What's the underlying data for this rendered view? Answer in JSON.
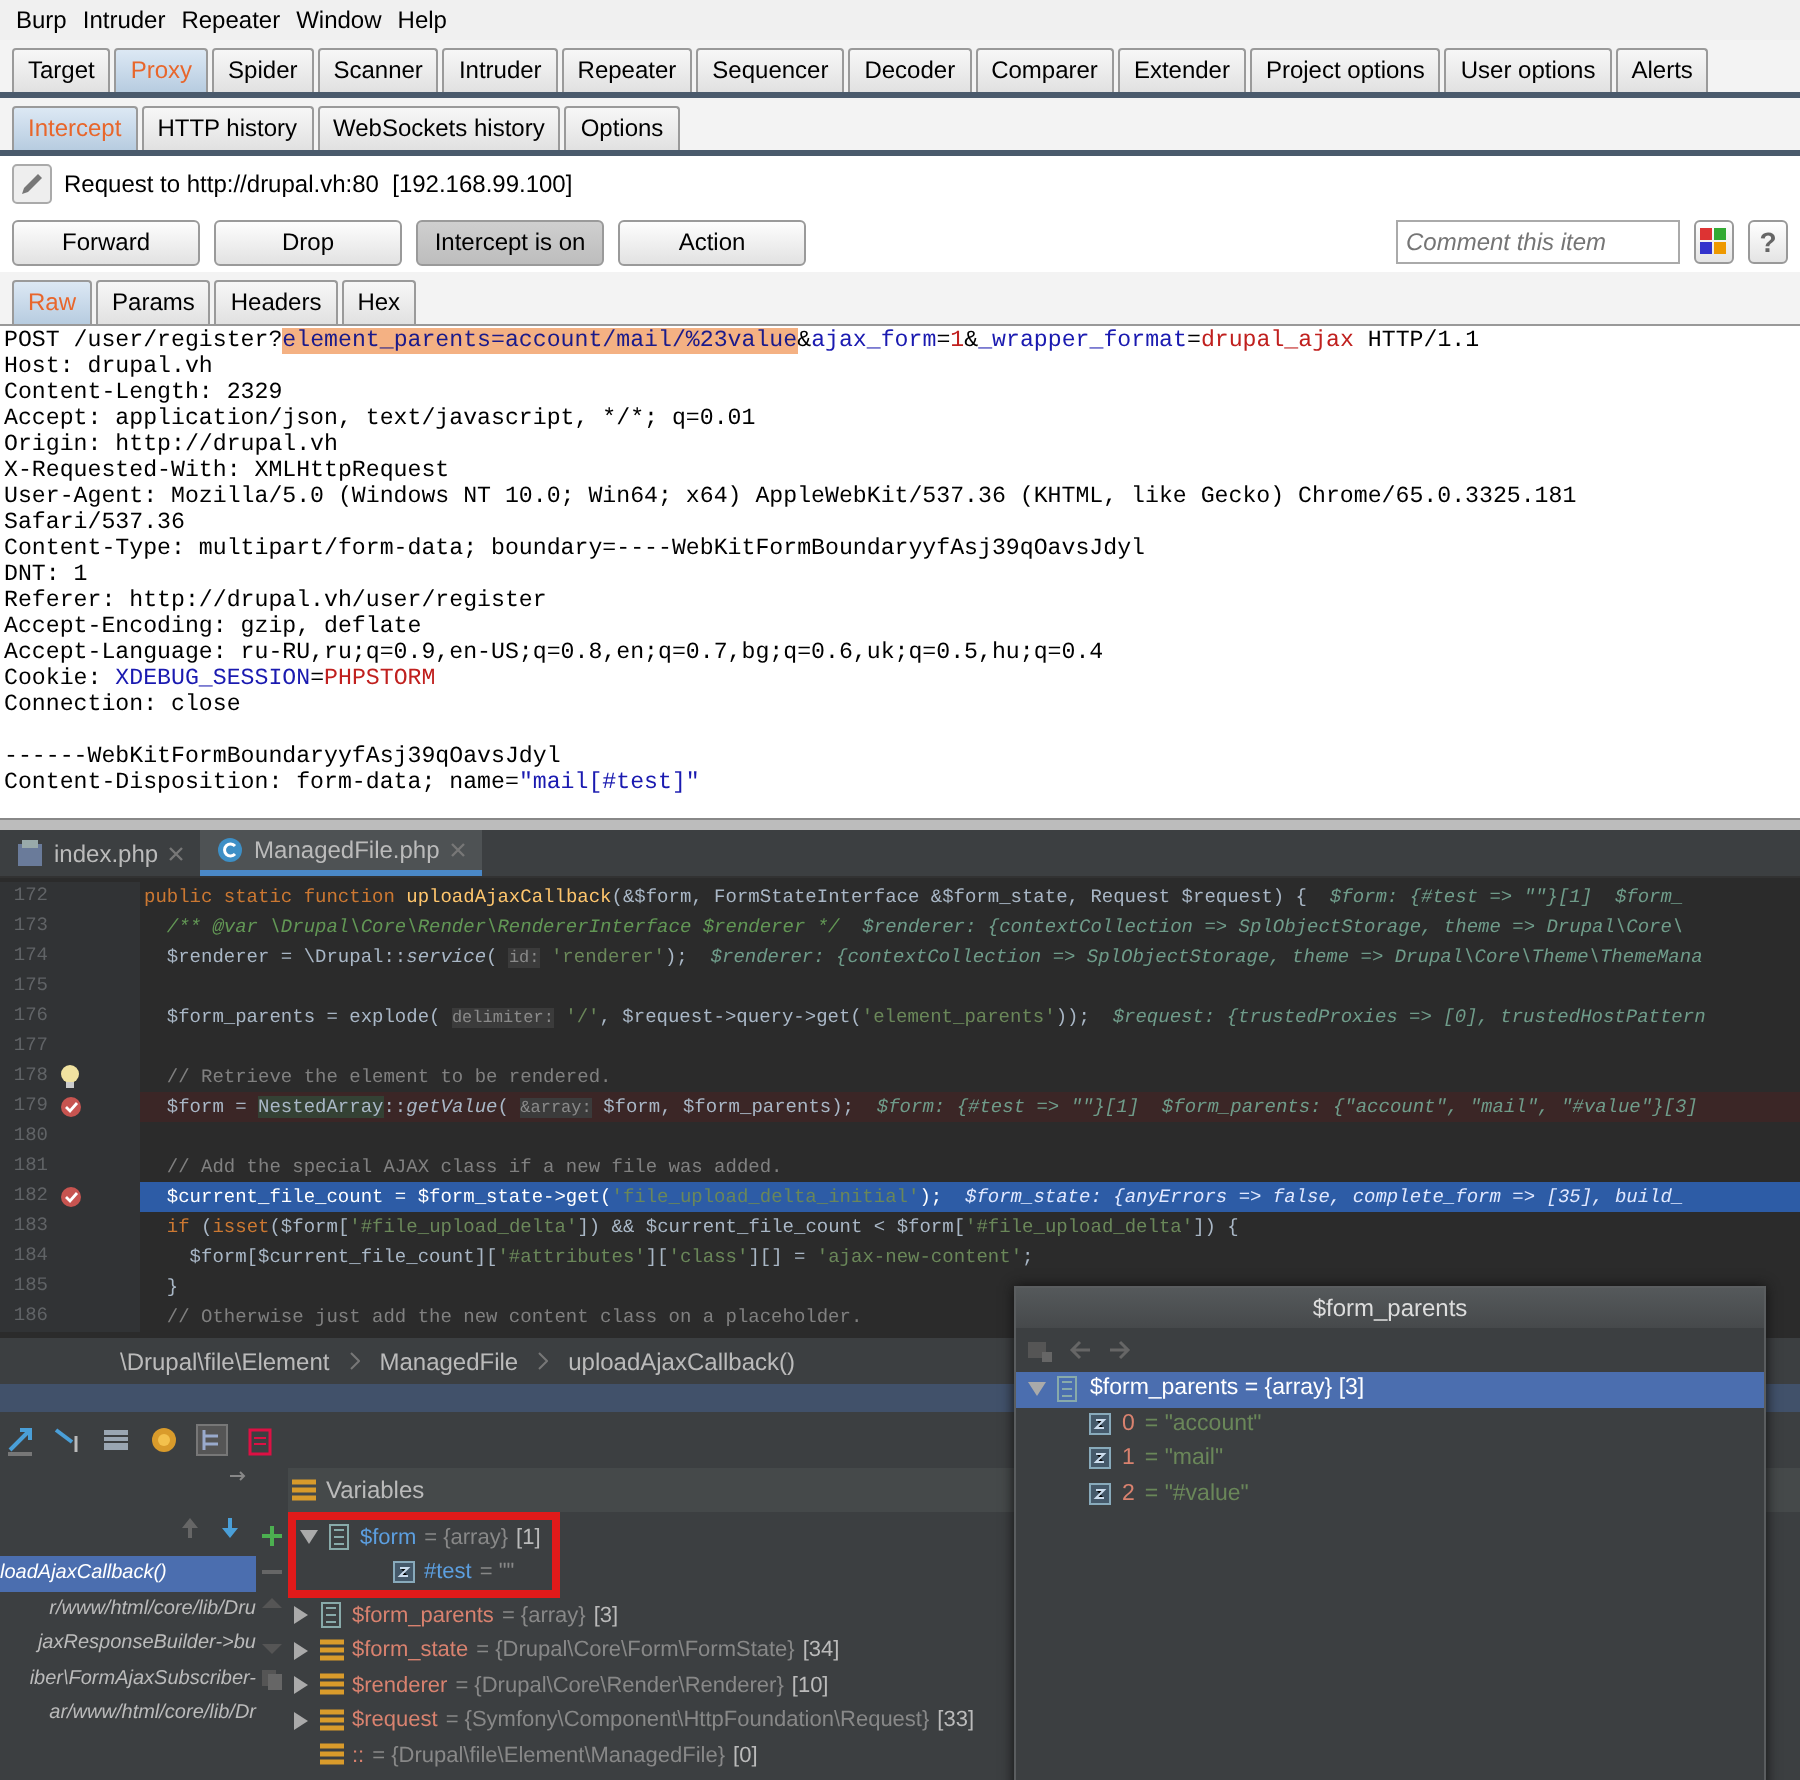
{
  "menu": [
    "Burp",
    "Intruder",
    "Repeater",
    "Window",
    "Help"
  ],
  "tabs": [
    {
      "label": "Target",
      "selected": false
    },
    {
      "label": "Proxy",
      "selected": true
    },
    {
      "label": "Spider",
      "selected": false
    },
    {
      "label": "Scanner",
      "selected": false
    },
    {
      "label": "Intruder",
      "selected": false
    },
    {
      "label": "Repeater",
      "selected": false
    },
    {
      "label": "Sequencer",
      "selected": false
    },
    {
      "label": "Decoder",
      "selected": false
    },
    {
      "label": "Comparer",
      "selected": false
    },
    {
      "label": "Extender",
      "selected": false
    },
    {
      "label": "Project options",
      "selected": false
    },
    {
      "label": "User options",
      "selected": false
    },
    {
      "label": "Alerts",
      "selected": false
    }
  ],
  "subtabs": [
    {
      "label": "Intercept",
      "selected": true
    },
    {
      "label": "HTTP history",
      "selected": false
    },
    {
      "label": "WebSockets history",
      "selected": false
    },
    {
      "label": "Options",
      "selected": false
    }
  ],
  "request_target": "Request to http://drupal.vh:80  [192.168.99.100]",
  "buttons": [
    {
      "label": "Forward",
      "pressed": false
    },
    {
      "label": "Drop",
      "pressed": false
    },
    {
      "label": "Intercept is on",
      "pressed": true
    },
    {
      "label": "Action",
      "pressed": false
    }
  ],
  "comment": {
    "placeholder": "Comment this item"
  },
  "help_button": "?",
  "view_tabs": [
    {
      "label": "Raw",
      "selected": true
    },
    {
      "label": "Params",
      "selected": false
    },
    {
      "label": "Headers",
      "selected": false
    },
    {
      "label": "Hex",
      "selected": false
    }
  ],
  "request_lines": [
    [
      {
        "text": "POST /user/register?",
        "kind": "plain"
      },
      {
        "text": "element_parents=account/mail/%23value",
        "kind": "selection"
      },
      {
        "text": "&",
        "kind": "plain"
      },
      {
        "text": "ajax_form",
        "kind": "key"
      },
      {
        "text": "=",
        "kind": "plain"
      },
      {
        "text": "1",
        "kind": "value"
      },
      {
        "text": "&",
        "kind": "plain"
      },
      {
        "text": "_wrapper_format",
        "kind": "key"
      },
      {
        "text": "=",
        "kind": "plain"
      },
      {
        "text": "drupal_ajax",
        "kind": "value"
      },
      {
        "text": " HTTP/1.1",
        "kind": "plain"
      }
    ],
    [
      {
        "text": "Host: drupal.vh",
        "kind": "plain"
      }
    ],
    [
      {
        "text": "Content-Length: 2329",
        "kind": "plain"
      }
    ],
    [
      {
        "text": "Accept: application/json, text/javascript, */*; q=0.01",
        "kind": "plain"
      }
    ],
    [
      {
        "text": "Origin: http://drupal.vh",
        "kind": "plain"
      }
    ],
    [
      {
        "text": "X-Requested-With: XMLHttpRequest",
        "kind": "plain"
      }
    ],
    [
      {
        "text": "User-Agent: Mozilla/5.0 (Windows NT 10.0; Win64; x64) AppleWebKit/537.36 (KHTML, like Gecko) Chrome/65.0.3325.181",
        "kind": "plain"
      }
    ],
    [
      {
        "text": "Safari/537.36",
        "kind": "plain"
      }
    ],
    [
      {
        "text": "Content-Type: multipart/form-data; boundary=----WebKitFormBoundaryyfAsj39qOavsJdyl",
        "kind": "plain"
      }
    ],
    [
      {
        "text": "DNT: 1",
        "kind": "plain"
      }
    ],
    [
      {
        "text": "Referer: http://drupal.vh/user/register",
        "kind": "plain"
      }
    ],
    [
      {
        "text": "Accept-Encoding: gzip, deflate",
        "kind": "plain"
      }
    ],
    [
      {
        "text": "Accept-Language: ru-RU,ru;q=0.9,en-US;q=0.8,en;q=0.7,bg;q=0.6,uk;q=0.5,hu;q=0.4",
        "kind": "plain"
      }
    ],
    [
      {
        "text": "Cookie: ",
        "kind": "plain"
      },
      {
        "text": "XDEBUG_SESSION",
        "kind": "key"
      },
      {
        "text": "=",
        "kind": "plain"
      },
      {
        "text": "PHPSTORM",
        "kind": "value"
      }
    ],
    [
      {
        "text": "Connection: close",
        "kind": "plain"
      }
    ],
    {
      "kind": "blank"
    },
    [
      {
        "text": "------WebKitFormBoundaryyfAsj39qOavsJdyl",
        "kind": "plain"
      }
    ],
    [
      {
        "text": "Content-Disposition: form-data; name=",
        "kind": "plain"
      },
      {
        "text": "\"mail[#test]\"",
        "kind": "key"
      }
    ]
  ],
  "editor_tabs": [
    {
      "label": "index.php",
      "kind": "php",
      "selected": false
    },
    {
      "label": "ManagedFile.php",
      "kind": "class",
      "selected": true
    }
  ],
  "code_lines": [
    {
      "number": "172",
      "kind": "plain",
      "bulb": false,
      "segments": [
        {
          "text": "public static function ",
          "kind": "kw"
        },
        {
          "text": "uploadAjaxCallback",
          "kind": "fn"
        },
        {
          "text": "(&$form, FormStateInterface &$form_state, Request $request) {  ",
          "kind": "plain"
        },
        {
          "text": "$form: {#test => \"\"}[1]  $form_",
          "kind": "hint"
        }
      ]
    },
    {
      "number": "173",
      "kind": "plain",
      "bulb": false,
      "segments": [
        {
          "text": "  /** @var \\Drupal\\Core\\Render\\RendererInterface $renderer */  ",
          "kind": "doc"
        },
        {
          "text": "$renderer: {contextCollection => SplObjectStorage, theme => Drupal\\Core\\",
          "kind": "hint"
        }
      ]
    },
    {
      "number": "174",
      "kind": "plain",
      "bulb": false,
      "segments": [
        {
          "text": "  $renderer = \\Drupal::",
          "kind": "plain"
        },
        {
          "text": "service",
          "kind": "static"
        },
        {
          "text": "( ",
          "kind": "plain"
        },
        {
          "text": "id:",
          "kind": "param"
        },
        {
          "text": " 'renderer'",
          "kind": "str"
        },
        {
          "text": ");  ",
          "kind": "plain"
        },
        {
          "text": "$renderer: {contextCollection => SplObjectStorage, theme => Drupal\\Core\\Theme\\ThemeMana",
          "kind": "hint"
        }
      ]
    },
    {
      "number": "175",
      "kind": "plain",
      "bulb": false
    },
    {
      "number": "176",
      "kind": "plain",
      "bulb": false,
      "segments": [
        {
          "text": "  $form_parents = explode( ",
          "kind": "plain"
        },
        {
          "text": "delimiter:",
          "kind": "param"
        },
        {
          "text": " '/'",
          "kind": "str"
        },
        {
          "text": ", $request->query->get(",
          "kind": "plain"
        },
        {
          "text": "'element_parents'",
          "kind": "str"
        },
        {
          "text": "));  ",
          "kind": "plain"
        },
        {
          "text": "$request: {trustedProxies => [0], trustedHostPattern",
          "kind": "hint"
        }
      ]
    },
    {
      "number": "177",
      "kind": "plain",
      "bulb": false
    },
    {
      "number": "178",
      "kind": "plain",
      "bulb": true,
      "segments": [
        {
          "text": "  // Retrieve the element to be rendered.",
          "kind": "cmt"
        }
      ]
    },
    {
      "number": "179",
      "kind": "breakpoint",
      "bulb": false,
      "segments": [
        {
          "text": "  $form = ",
          "kind": "plain"
        },
        {
          "text": "NestedArray",
          "kind": "usage"
        },
        {
          "text": "::",
          "kind": "plain"
        },
        {
          "text": "getValue",
          "kind": "static"
        },
        {
          "text": "( ",
          "kind": "plain"
        },
        {
          "text": "&array:",
          "kind": "param"
        },
        {
          "text": " $form, $form_parents);  ",
          "kind": "plain"
        },
        {
          "text": "$form: {#test => \"\"}[1]  $form_parents: {\"account\", \"mail\", \"#value\"}[3]",
          "kind": "hint"
        }
      ]
    },
    {
      "number": "180",
      "kind": "plain",
      "bulb": false
    },
    {
      "number": "181",
      "kind": "plain",
      "bulb": false,
      "segments": [
        {
          "text": "  // Add the special AJAX class if a new file was added.",
          "kind": "cmt"
        }
      ]
    },
    {
      "number": "182",
      "kind": "execution",
      "bulb": false,
      "segments": [
        {
          "text": "  $current_file_count = $form_state->get(",
          "kind": "plain"
        },
        {
          "text": "'file_upload_delta_initial'",
          "kind": "str"
        },
        {
          "text": ");  ",
          "kind": "plain"
        },
        {
          "text": "$form_state: {anyErrors => false, complete_form => [35], build_",
          "kind": "hint"
        }
      ]
    },
    {
      "number": "183",
      "kind": "plain",
      "bulb": false,
      "segments": [
        {
          "text": "  if ",
          "kind": "kw"
        },
        {
          "text": "(",
          "kind": "plain"
        },
        {
          "text": "isset",
          "kind": "kw"
        },
        {
          "text": "($form[",
          "kind": "plain"
        },
        {
          "text": "'#file_upload_delta'",
          "kind": "str"
        },
        {
          "text": "]) && $current_file_count < $form[",
          "kind": "plain"
        },
        {
          "text": "'#file_upload_delta'",
          "kind": "str"
        },
        {
          "text": "]) {",
          "kind": "plain"
        }
      ]
    },
    {
      "number": "184",
      "kind": "plain",
      "bulb": false,
      "segments": [
        {
          "text": "    $form[$current_file_count][",
          "kind": "plain"
        },
        {
          "text": "'#attributes'",
          "kind": "str"
        },
        {
          "text": "][",
          "kind": "plain"
        },
        {
          "text": "'class'",
          "kind": "str"
        },
        {
          "text": "][] = ",
          "kind": "plain"
        },
        {
          "text": "'ajax-new-content'",
          "kind": "str"
        },
        {
          "text": ";",
          "kind": "plain"
        }
      ]
    },
    {
      "number": "185",
      "kind": "plain",
      "bulb": false,
      "segments": [
        {
          "text": "  }",
          "kind": "plain"
        }
      ]
    },
    {
      "number": "186",
      "kind": "plain",
      "bulb": false,
      "segments": [
        {
          "text": "  // Otherwise just add the new content class on a placeholder.",
          "kind": "cmt"
        }
      ]
    }
  ],
  "breadcrumb": [
    "\\Drupal\\file\\Element",
    "ManagedFile",
    "uploadAjaxCallback()"
  ],
  "debugger": {
    "variables_title": "Variables",
    "frames": [
      {
        "text": "loadAjaxCallback()",
        "selected": true
      },
      {
        "text": "r/www/html/core/lib/Dru",
        "selected": false
      },
      {
        "text": "jaxResponseBuilder->bu",
        "selected": false
      },
      {
        "text": "iber\\FormAjaxSubscriber-",
        "selected": false
      },
      {
        "text": "ar/www/html/core/lib/Dr",
        "selected": false
      }
    ],
    "variables": [
      {
        "name": "$form",
        "value": "= {array}",
        "count": "[1]",
        "kind": "array",
        "expanded": true,
        "changed": true,
        "annotated": true,
        "children": [
          {
            "name": "#test",
            "value": "= \"\"",
            "kind": "scalar",
            "changed": true
          }
        ]
      },
      {
        "name": "$form_parents",
        "value": "= {array}",
        "count": "[3]",
        "kind": "array",
        "expanded": false,
        "changed": false,
        "annotated": false
      },
      {
        "name": "$form_state",
        "value": "= {Drupal\\Core\\Form\\FormState}",
        "count": "[34]",
        "kind": "object",
        "expanded": false,
        "changed": false,
        "annotated": false
      },
      {
        "name": "$renderer",
        "value": "= {Drupal\\Core\\Render\\Renderer}",
        "count": "[10]",
        "kind": "object",
        "expanded": false,
        "changed": false,
        "annotated": false
      },
      {
        "name": "$request",
        "value": "= {Symfony\\Component\\HttpFoundation\\Request}",
        "count": "[33]",
        "kind": "object",
        "expanded": false,
        "changed": false,
        "annotated": false
      },
      {
        "name": "::",
        "value": "= {Drupal\\file\\Element\\ManagedFile}",
        "count": "[0]",
        "kind": "static",
        "changed": false,
        "annotated": false
      }
    ]
  },
  "popup": {
    "title": "$form_parents",
    "root": {
      "name": "$form_parents",
      "value": "= {array}",
      "count": "[3]",
      "expanded": true,
      "selected": true
    },
    "items": [
      {
        "key": "0",
        "value": "= \"account\""
      },
      {
        "key": "1",
        "value": "= \"mail\""
      },
      {
        "key": "2",
        "value": "= \"#value\""
      }
    ]
  }
}
